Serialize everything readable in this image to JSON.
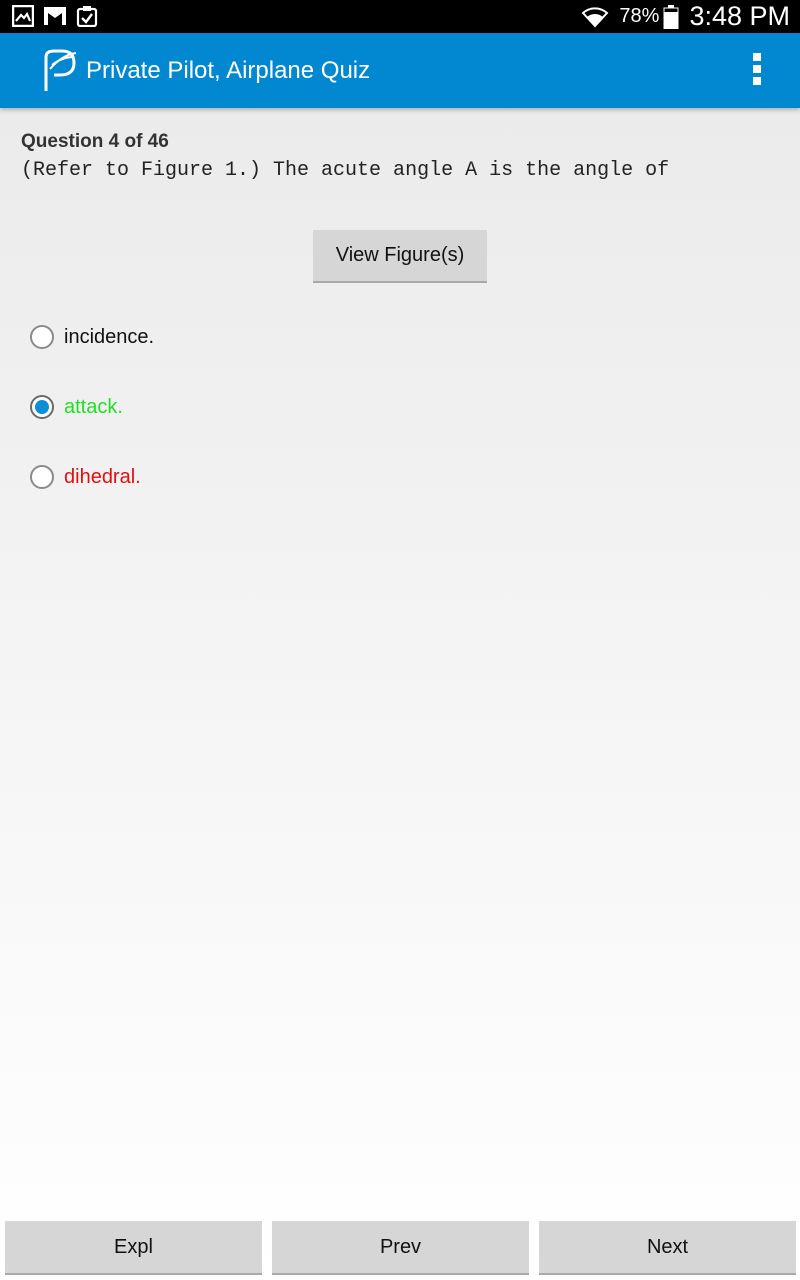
{
  "status_bar": {
    "notification_icons": [
      "gallery-icon",
      "gmail-icon",
      "clipboard-check-icon"
    ],
    "wifi_icon": "wifi-icon",
    "battery_percent": "78%",
    "time": "3:48 PM"
  },
  "app_bar": {
    "logo_icon": "app-logo-icon",
    "title": "Private Pilot, Airplane Quiz",
    "menu_icon": "overflow-menu-icon",
    "color": "#0288d1"
  },
  "question": {
    "number_label": "Question 4 of 46",
    "text": "(Refer to Figure 1.) The acute angle A is the angle of",
    "view_figure_label": "View Figure(s)"
  },
  "options": [
    {
      "label": "incidence.",
      "selected": false,
      "color": "#111111"
    },
    {
      "label": "attack.",
      "selected": true,
      "color": "#22dd22"
    },
    {
      "label": "dihedral.",
      "selected": false,
      "color": "#e01010"
    }
  ],
  "bottom_bar": {
    "expl_label": "Expl",
    "prev_label": "Prev",
    "next_label": "Next"
  }
}
